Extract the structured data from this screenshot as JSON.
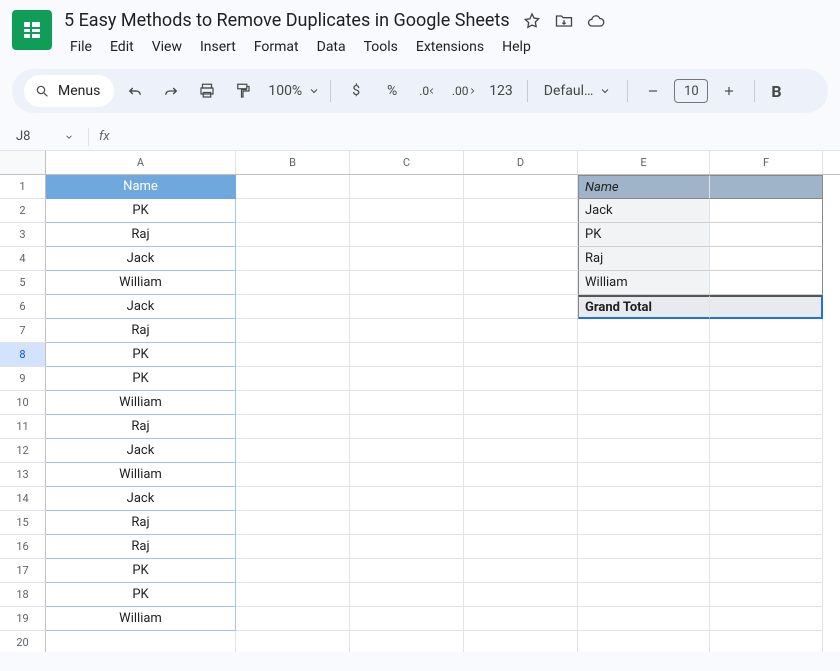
{
  "doc": {
    "title": "5 Easy Methods to Remove Duplicates in Google Sheets"
  },
  "menus": {
    "file": "File",
    "edit": "Edit",
    "view": "View",
    "insert": "Insert",
    "format": "Format",
    "data": "Data",
    "tools": "Tools",
    "extensions": "Extensions",
    "help": "Help"
  },
  "toolbar": {
    "menus_label": "Menus",
    "zoom": "100%",
    "currency": "$",
    "percent": "%",
    "dec_dec": ".0",
    "inc_dec": ".00",
    "num123": "123",
    "font_name": "Defaul…",
    "font_size": "10",
    "bold": "B"
  },
  "namebox": {
    "ref": "J8"
  },
  "fx": {
    "label": "fx"
  },
  "columns": [
    "A",
    "B",
    "C",
    "D",
    "E",
    "F"
  ],
  "colA": {
    "header": "Name",
    "values": [
      "PK",
      "Raj",
      "Jack",
      "William",
      "Jack",
      "Raj",
      "PK",
      "PK",
      "William",
      "Raj",
      "Jack",
      "William",
      "Jack",
      "Raj",
      "Raj",
      "PK",
      "PK",
      "William"
    ]
  },
  "pivot": {
    "header": "Name",
    "rows": [
      "Jack",
      "PK",
      "Raj",
      "William"
    ],
    "total": "Grand Total"
  },
  "selected_row": 8,
  "last_visible_row": 20
}
